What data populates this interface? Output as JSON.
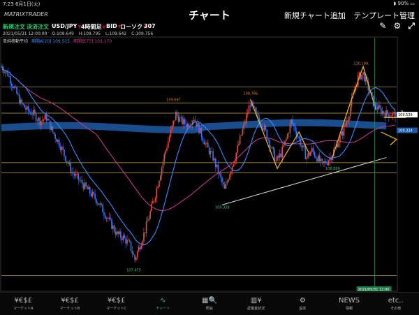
{
  "status": {
    "time": "7:23",
    "date": "6月1日(火)",
    "battery": "90%"
  },
  "header": {
    "logo": "MATRIXTRADER",
    "title": "チャート",
    "add_chart": "新規チャート追加",
    "template": "テンプレート管理"
  },
  "toolbar": {
    "new_order": "新規注文",
    "close_order": "決済注文",
    "pair": "USD/JPY",
    "timeframe": "4時間足",
    "side": "BID",
    "candle_type": "ローソク",
    "count": "307"
  },
  "ohlc": {
    "datetime": "2021/05/31 12:00:00",
    "open": "O:109.649",
    "high": "H:109.795",
    "low": "L:109.642",
    "close": "C:109.756"
  },
  "legend": {
    "indicator": "単純移動平均",
    "sma_a": "期間A[20] 109.515",
    "sma_b": "期間B[75] 109.170"
  },
  "chart_data": {
    "type": "candlestick",
    "ylim": [
      107.2,
      110.5
    ],
    "x_range": [
      0,
      307
    ],
    "annotations": [
      {
        "text": "110.199",
        "x": 280,
        "y": 110.199
      },
      {
        "text": "109.697",
        "x": 134,
        "y": 109.697
      },
      {
        "text": "109.786",
        "x": 194,
        "y": 109.786
      },
      {
        "text": "108.869",
        "x": 258,
        "y": 108.869
      },
      {
        "text": "108.339",
        "x": 172,
        "y": 108.339
      },
      {
        "text": "107.475",
        "x": 103,
        "y": 107.475
      }
    ],
    "horizontal_lines": [
      109.92,
      109.7,
      109.56,
      108.88,
      108.74,
      107.33
    ],
    "price_markers": [
      {
        "text": "109.539",
        "y": 109.539
      },
      {
        "text": "109.324",
        "y": 109.324
      }
    ],
    "crosshair": {
      "x": 291,
      "label": "2021/05/31 12:00"
    },
    "anchor_points": [
      [
        0,
        110.2
      ],
      [
        5,
        110.1
      ],
      [
        10,
        109.9
      ],
      [
        15,
        109.7
      ],
      [
        20,
        109.6
      ],
      [
        25,
        109.55
      ],
      [
        30,
        109.45
      ],
      [
        35,
        109.5
      ],
      [
        40,
        109.3
      ],
      [
        45,
        109.15
      ],
      [
        50,
        108.95
      ],
      [
        55,
        108.75
      ],
      [
        60,
        108.65
      ],
      [
        65,
        108.55
      ],
      [
        70,
        108.45
      ],
      [
        75,
        108.35
      ],
      [
        80,
        108.2
      ],
      [
        85,
        108.05
      ],
      [
        90,
        107.9
      ],
      [
        95,
        107.85
      ],
      [
        100,
        107.75
      ],
      [
        104,
        107.55
      ],
      [
        108,
        107.75
      ],
      [
        112,
        107.95
      ],
      [
        116,
        108.2
      ],
      [
        120,
        108.45
      ],
      [
        124,
        108.75
      ],
      [
        128,
        109.05
      ],
      [
        132,
        109.3
      ],
      [
        136,
        109.55
      ],
      [
        140,
        109.45
      ],
      [
        145,
        109.4
      ],
      [
        150,
        109.5
      ],
      [
        155,
        109.3
      ],
      [
        160,
        109.1
      ],
      [
        165,
        108.95
      ],
      [
        170,
        108.7
      ],
      [
        174,
        108.5
      ],
      [
        178,
        108.75
      ],
      [
        182,
        108.95
      ],
      [
        186,
        109.2
      ],
      [
        190,
        109.45
      ],
      [
        194,
        109.7
      ],
      [
        198,
        109.55
      ],
      [
        202,
        109.45
      ],
      [
        206,
        109.3
      ],
      [
        210,
        109.1
      ],
      [
        214,
        108.9
      ],
      [
        218,
        109.0
      ],
      [
        222,
        109.2
      ],
      [
        226,
        109.45
      ],
      [
        230,
        109.3
      ],
      [
        234,
        109.1
      ],
      [
        238,
        108.95
      ],
      [
        242,
        109.05
      ],
      [
        246,
        108.95
      ],
      [
        250,
        108.85
      ],
      [
        254,
        108.9
      ],
      [
        258,
        109.0
      ],
      [
        262,
        109.15
      ],
      [
        266,
        109.3
      ],
      [
        270,
        109.5
      ],
      [
        274,
        109.8
      ],
      [
        278,
        110.05
      ],
      [
        282,
        110.1
      ],
      [
        286,
        109.9
      ],
      [
        290,
        109.7
      ],
      [
        295,
        109.6
      ],
      [
        300,
        109.55
      ],
      [
        307,
        109.54
      ]
    ],
    "sma_a_name": "期間A[20]",
    "sma_b_name": "期間B[75]",
    "colors": {
      "up": "#e74c3c",
      "down": "#3478ff",
      "sma_a": "#3d8bff",
      "sma_b": "#c0398c",
      "hline": "#c8a850",
      "trend": "#dddddd",
      "hand": "#e9b32b",
      "band": "#1f5aa6"
    }
  },
  "tabs": [
    {
      "icon": "¥€$£",
      "label": "マーケットA"
    },
    {
      "icon": "¥€$£",
      "label": "マーケットB"
    },
    {
      "icon": "¥€$£",
      "label": "マーケットC"
    },
    {
      "icon": "∿",
      "label": "チャート"
    },
    {
      "icon": "▦🔍",
      "label": "照会"
    },
    {
      "icon": "▥¥",
      "label": "証拠金状況"
    },
    {
      "icon": "⚙",
      "label": "設定"
    },
    {
      "icon": "NEWS",
      "label": "情報"
    },
    {
      "icon": "etc..",
      "label": "その他"
    }
  ]
}
